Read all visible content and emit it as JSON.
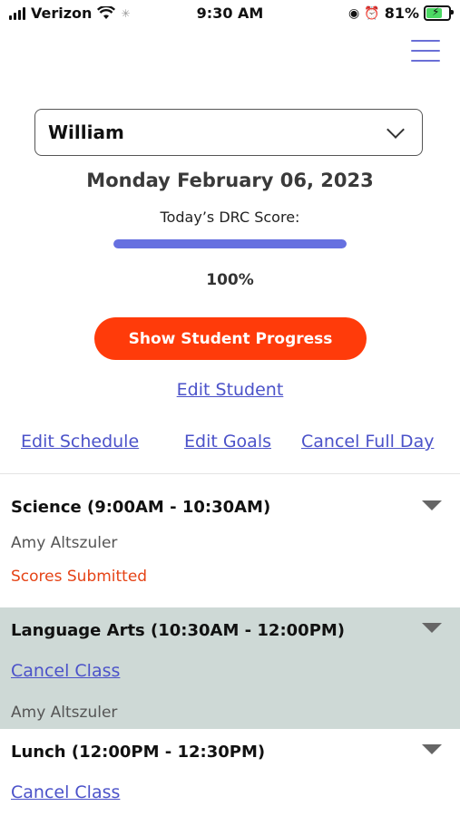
{
  "status_bar": {
    "carrier": "Verizon",
    "time": "9:30 AM",
    "battery_percent": "81%"
  },
  "student": {
    "selected": "William"
  },
  "date": "Monday February 06, 2023",
  "drc": {
    "label": "Today’s DRC Score:",
    "percent_text": "100%",
    "progress_value": 1.0,
    "progress_color": "#6670e0"
  },
  "buttons": {
    "show_progress": "Show Student Progress",
    "edit_student": "Edit Student",
    "edit_schedule": "Edit Schedule",
    "edit_goals": "Edit Goals",
    "cancel_full_day": "Cancel Full Day"
  },
  "colors": {
    "accent": "#ff3b0a",
    "link": "#4b52c9",
    "highlight_row": "#ced9d6",
    "submitted": "#e54316"
  },
  "classes": [
    {
      "title": "Science (9:00AM - 10:30AM)",
      "teacher": "Amy Altszuler",
      "status": "Scores Submitted"
    },
    {
      "title": "Language Arts (10:30AM - 12:00PM)",
      "cancel_label": "Cancel Class",
      "teacher": "Amy Altszuler"
    },
    {
      "title": "Lunch (12:00PM - 12:30PM)",
      "cancel_label": "Cancel Class"
    }
  ]
}
